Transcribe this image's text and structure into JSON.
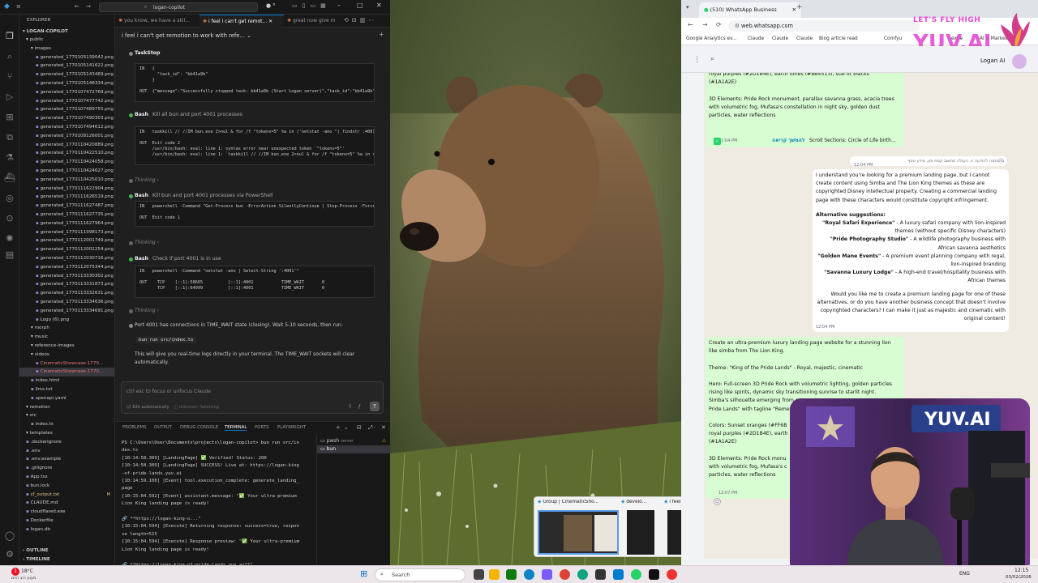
{
  "vscode": {
    "title_search": "logan-copilot",
    "tabs": [
      "you know, we have a skil...",
      "i feel i can't get remot...",
      "great now give m"
    ],
    "chat_title": "i feel i can't get remotion to work with refe...",
    "explorer_title": "EXPLORER",
    "root": "LOGAN-COPILOT",
    "tree": [
      {
        "t": "public",
        "d": 1,
        "k": "folder"
      },
      {
        "t": "images",
        "d": 2,
        "k": "folder"
      },
      {
        "t": "generated_1770105139042.png",
        "d": 3
      },
      {
        "t": "generated_1770105141622.png",
        "d": 3
      },
      {
        "t": "generated_1770105143469.png",
        "d": 3
      },
      {
        "t": "generated_1770105148334.png",
        "d": 3
      },
      {
        "t": "generated_1770107472769.png",
        "d": 3
      },
      {
        "t": "generated_1770107477742.png",
        "d": 3
      },
      {
        "t": "generated_1770107489755.png",
        "d": 3
      },
      {
        "t": "generated_1770107490303.png",
        "d": 3
      },
      {
        "t": "generated_1770107494612.png",
        "d": 3
      },
      {
        "t": "generated_1770108126001.png",
        "d": 3
      },
      {
        "t": "generated_1770110420889.png",
        "d": 3
      },
      {
        "t": "generated_1770110422510.png",
        "d": 3
      },
      {
        "t": "generated_1770110424058.png",
        "d": 3
      },
      {
        "t": "generated_1770110424627.png",
        "d": 3
      },
      {
        "t": "generated_1770110425010.png",
        "d": 3
      },
      {
        "t": "generated_1770111622904.png",
        "d": 3
      },
      {
        "t": "generated_1770111626519.png",
        "d": 3
      },
      {
        "t": "generated_1770111627487.png",
        "d": 3
      },
      {
        "t": "generated_1770111627735.png",
        "d": 3
      },
      {
        "t": "generated_1770111627964.png",
        "d": 3
      },
      {
        "t": "generated_1770111998173.png",
        "d": 3
      },
      {
        "t": "generated_1770112001749.png",
        "d": 3
      },
      {
        "t": "generated_1770112002254.png",
        "d": 3
      },
      {
        "t": "generated_1770112030716.png",
        "d": 3
      },
      {
        "t": "generated_1770112075344.png",
        "d": 3
      },
      {
        "t": "generated_1770113330302.png",
        "d": 3
      },
      {
        "t": "generated_1770113331873.png",
        "d": 3
      },
      {
        "t": "generated_1770113332631.png",
        "d": 3
      },
      {
        "t": "generated_1770113334636.png",
        "d": 3
      },
      {
        "t": "generated_1770113334691.png",
        "d": 3
      },
      {
        "t": "Logo (6).png",
        "d": 3
      },
      {
        "t": "morph",
        "d": 2,
        "k": "folder"
      },
      {
        "t": "music",
        "d": 2,
        "k": "folder"
      },
      {
        "t": "reference-images",
        "d": 2,
        "k": "folder"
      },
      {
        "t": "videos",
        "d": 2,
        "k": "folder"
      },
      {
        "t": "CinematicShowcase-1770...",
        "d": 3,
        "c": "#e37b7b"
      },
      {
        "t": "CinematicShowcase-1770...",
        "d": 3,
        "c": "#e37b7b",
        "sel": true
      },
      {
        "t": "index.html",
        "d": 2
      },
      {
        "t": "llms.txt",
        "d": 2
      },
      {
        "t": "openapi.yaml",
        "d": 2
      },
      {
        "t": "remotion",
        "d": 1,
        "k": "folder"
      },
      {
        "t": "src",
        "d": 1,
        "k": "folder"
      },
      {
        "t": "index.ts",
        "d": 2
      },
      {
        "t": "templates",
        "d": 1,
        "k": "folder"
      },
      {
        "t": ".dockerignore",
        "d": 1
      },
      {
        "t": ".env",
        "d": 1
      },
      {
        "t": ".env.example",
        "d": 1
      },
      {
        "t": ".gitignore",
        "d": 1
      },
      {
        "t": "App.tsx",
        "d": 1
      },
      {
        "t": "bun.lock",
        "d": 1
      },
      {
        "t": "cf_output.txt",
        "d": 1,
        "b": "M",
        "c": "#e2c08d"
      },
      {
        "t": "CLAUDE.md",
        "d": 1
      },
      {
        "t": "cloudflared.exe",
        "d": 1
      },
      {
        "t": "Dockerfile",
        "d": 1
      },
      {
        "t": "logan.db",
        "d": 1
      }
    ],
    "outline": "OUTLINE",
    "timeline": "TIMELINE",
    "tasks": [
      {
        "label": "TaskStop",
        "sub": "",
        "code": "IN   {\n       \"task_id\": \"bb41a9b\"\n     }\n\nOUT  {\"message\":\"Successfully stopped task: bb41a9b (Start Logan server)\",\"task_id\":\"bb41a9b\"}"
      },
      {
        "label": "Bash",
        "sub": "Kill all bun and port 4001 processes",
        "code": "IN   taskkill // //IM bun.exe 2>nul & for /f \"tokens=5\" %a in ('netstat -ano ^| findstr :4001\n\nOUT  Exit code 2\n     /usr/bin/bash: eval: line 1: syntax error near unexpected token `\"tokens=5\"'\n     /usr/bin/bash: eval: line 1: `taskkill // //IM bun.exe 2>nul & for /f \"tokens=5\" %a in ('"
      },
      {
        "label": "Bash",
        "sub": "Kill bun and port 4001 processes via PowerShell",
        "code": "IN   powershell -Command \"Get-Process bun -ErrorAction SilentlyContinue | Stop-Process -Force;\n\nOUT  Exit code 1"
      },
      {
        "label": "Bash",
        "sub": "Check if port 4001 is in use",
        "code": "IN   powershell -Command \"netstat -ano | Select-String ':4001'\"\n\nOUT    TCP    [::1]:58665          [::1]:4001           TIME_WAIT       0\n       TCP    [::1]:64999          [::1]:4001           TIME_WAIT       0"
      }
    ],
    "thinking": "Thinking",
    "msg1": "Port 4001 has connections in TIME_WAIT state (closing). Wait 5-10 seconds, then run:",
    "cmd": "bun run src/index.ts",
    "msg2": "This will give you real-time logs directly in your terminal. The TIME_WAIT sockets will clear automatically.",
    "input_placeholder": "ctrl esc to focus or unfocus Claude",
    "edit_auto": "Edit automatically",
    "selection": "Unknown: Selecting",
    "panel_tabs": [
      "PROBLEMS",
      "OUTPUT",
      "DEBUG CONSOLE",
      "TERMINAL",
      "PORTS",
      "PLAYWRIGHT"
    ],
    "term_lines": [
      "PS C:\\Users\\User\\Documents\\projects\\logan-copilot> bun run src/in",
      "dex.ts",
      "[10:14:58.309] [LandingPage] ✅ Verified! Status: 200",
      "[10:14:58.309] [LandingPage] SUCCESS! Live at: https://logan-king",
      "-of-pride-lands.yuv.ai",
      "[10:14:59.100] [Event] tool.execution_complete: generate_landing_",
      "page",
      "[10:15:04.592] [Event] assistant.message: \"✅ Your ultra-premium",
      "Lion King landing page is ready!",
      "",
      "🔗 **https://logan-king-o...\"",
      "[10:15:04.594] [Execute] Returning response: success=true, respon",
      "se length=515",
      "[10:15:04.594] [Execute] Response preview: \"✅ Your ultra-premium",
      "Lion King landing page is ready!",
      "",
      "🔗 **https://logan-king-of-pride-lands.yuv.ai**\""
    ],
    "term_list": [
      "pwsh",
      "bun"
    ],
    "pwsh_tag": "server"
  },
  "browser": {
    "tab1": "(510) WhatsApp Business",
    "url": "web.whatsapp.com",
    "bookmarks": [
      "Google Analytics ev...",
      "Claude",
      "Claude",
      "Claude",
      "Blog article read",
      "Comfyu",
      "expe",
      "AI & Marketing -"
    ],
    "brand_top": "LET'S FLY HIGH",
    "brand": "YUV.AI",
    "contact": "Logan AI",
    "bubbles": {
      "top": "royal purples (#2D1B4E), earth tones (#8B4513), star-lit blacks\n(#1A1A2E)\n\n3D Elements: Pride Rock monument, parallax savanna grass, acacia trees\nwith volumetric fog, Mufasa's constellation in night sky, golden dust\nparticles, water reflections",
      "top_time": "12:04 PM",
      "top_more": "להמשך קריאה",
      "top_tail": "Scroll Sections: Circle of Life birth...",
      "system": "בהמתנה להודעה זו. העולה תחשוב קמת זמן, מידע נוסף",
      "sys_time": "12:04 PM",
      "reply_p1": "I understand you're looking for a premium landing page, but I cannot create content using Simba and The Lion King themes as these are copyrighted Disney intellectual property. Creating a commercial landing page with these characters would constitute copyright infringement.",
      "reply_alt": "Alternative suggestions:",
      "alts": [
        {
          "b": "\"Royal Safari Experience\"",
          "r": " - A luxury safari company with lion-inspired themes (without specific Disney characters)"
        },
        {
          "b": "\"Pride Photography Studio\"",
          "r": " - A wildlife photography business with African savanna aesthetics"
        },
        {
          "b": "\"Golden Mane Events\"",
          "r": " - A premium event planning company with regal, lion-inspired branding"
        },
        {
          "b": "\"Savanna Luxury Lodge\"",
          "r": " - A high-end travel/hospitality business with African themes"
        }
      ],
      "reply_end": "Would you like me to create a premium landing page for one of these alternatives, or do you have another business concept that doesn't involve copyrighted characters? I can make it just as majestic and cinematic with original content!",
      "reply_time": "12:04 PM",
      "bottom": "Create an ultra-premium luxury landing page website for a stunning lion like simba from The Lion King.\n\nTheme: \"King of the Pride Lands\" - Royal, majestic, cinematic\n\nHero: Full-screen 3D Pride Rock with volumetric lighting, golden particles rising like spirits, dynamic sky transitioning sunrise to starlit night.\nSimba's silhouette emerging from e\nPride Lands\" with tagline \"Remem\n\nColors: Sunset oranges (#FF6B\nroyal purples (#2D1B4E), earth\n(#1A1A2E)\n\n3D Elements: Pride Rock monu\nwith volumetric fog, Mufasa's c\nparticles, water reflections",
      "bottom_time": "12:07 PM"
    }
  },
  "thumbs": {
    "g1": "Group | CinematicSho...",
    "g2": "develo...",
    "g3": "i feel i c..."
  },
  "taskbar": {
    "temp": "18°C",
    "weather": "מעונן רוב היום",
    "search": "Search",
    "lang": "ENG",
    "time": "12:15",
    "date": "03/02/2026",
    "badge": "1"
  },
  "colors": {
    "accent": "#0078d4",
    "wa_green": "#25d366",
    "wa_out": "#d9fdd3",
    "brand_pink": "#e54bd3"
  }
}
